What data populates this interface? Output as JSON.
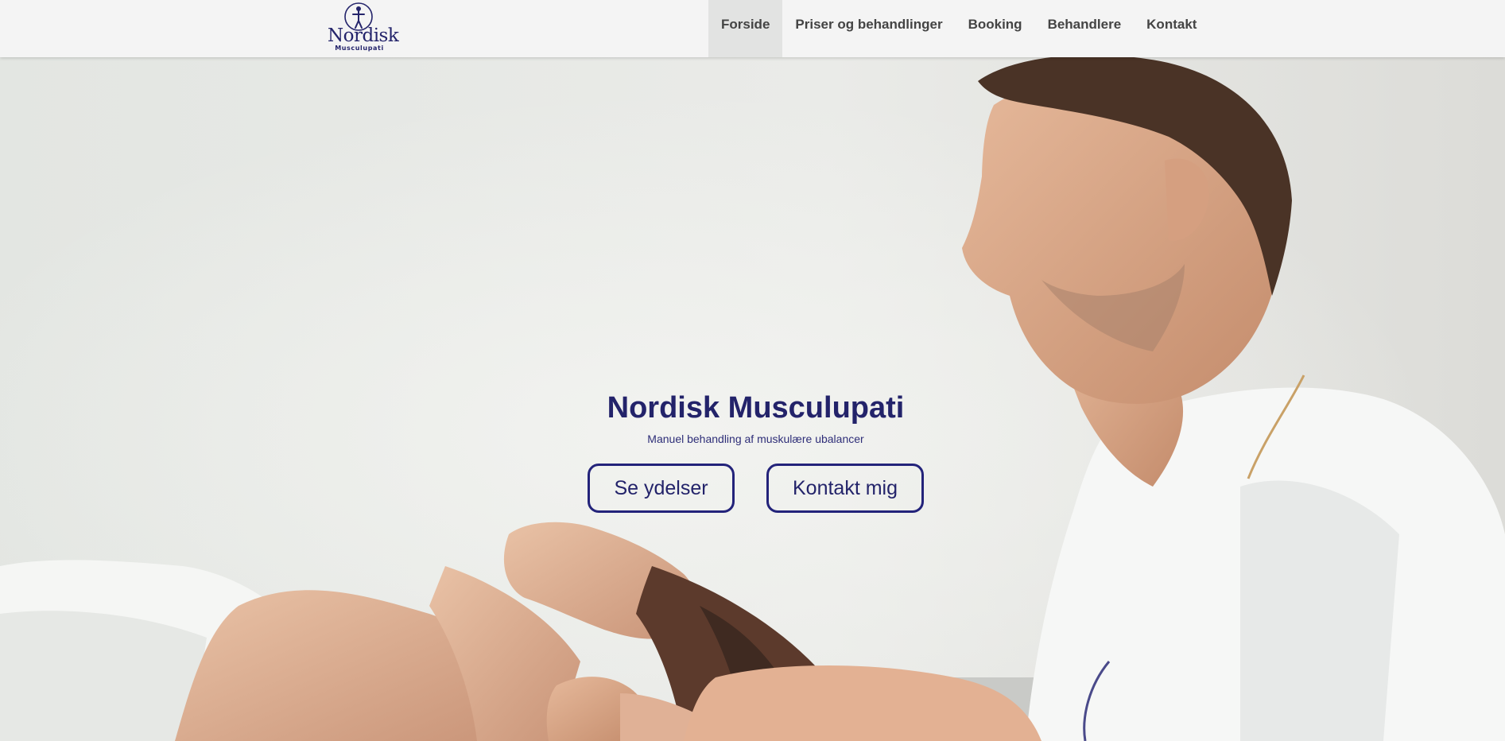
{
  "header": {
    "logo": {
      "word": "Nordisk",
      "sub": "Musculupati"
    },
    "nav": [
      {
        "label": "Forside",
        "active": true
      },
      {
        "label": "Priser og behandlinger",
        "active": false
      },
      {
        "label": "Booking",
        "active": false
      },
      {
        "label": "Behandlere",
        "active": false
      },
      {
        "label": "Kontakt",
        "active": false
      }
    ]
  },
  "hero": {
    "title": "Nordisk Musculupati",
    "subtitle": "Manuel behandling af muskulære ubalancer",
    "buttons": {
      "services": "Se ydelser",
      "contact": "Kontakt mig"
    }
  },
  "colors": {
    "brand": "#23236a",
    "header_bg": "#f4f4f4",
    "nav_active_bg": "#e2e3e2",
    "nav_text": "#444444"
  }
}
